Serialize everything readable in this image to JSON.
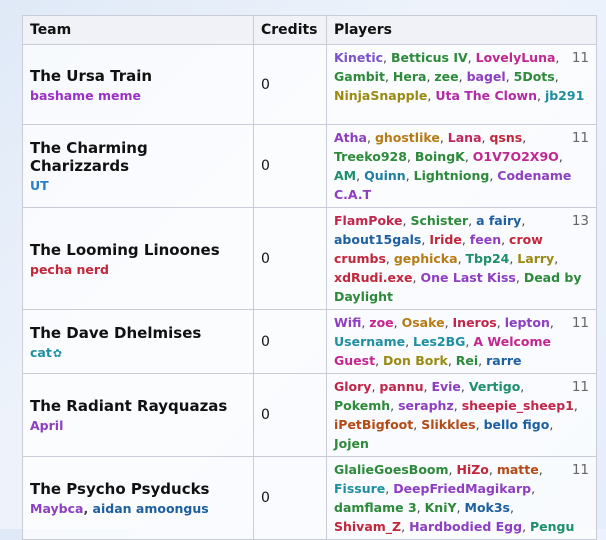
{
  "headers": {
    "team": "Team",
    "credits": "Credits",
    "players": "Players"
  },
  "teams": [
    {
      "name": "The Ursa Train",
      "captains": [
        {
          "name": "bashame meme",
          "color": "#9b30c8"
        }
      ],
      "credits": "0",
      "count": "11",
      "players": [
        {
          "name": "Kinetic",
          "color": "#7a52c9"
        },
        {
          "name": "Betticus IV",
          "color": "#2d8a3a"
        },
        {
          "name": "LovelyLuna",
          "color": "#c2268f"
        },
        {
          "name": "Gambit",
          "color": "#2d8a3a"
        },
        {
          "name": "Hera",
          "color": "#2d8a3a"
        },
        {
          "name": "zee",
          "color": "#2d8a3a"
        },
        {
          "name": "bagel",
          "color": "#8e3fc1"
        },
        {
          "name": "5Dots",
          "color": "#2d8a3a"
        },
        {
          "name": "NinjaSnapple",
          "color": "#9a8a12"
        },
        {
          "name": "Uta The Clown",
          "color": "#b42aa5"
        },
        {
          "name": "jb291",
          "color": "#1e8fa0"
        }
      ]
    },
    {
      "name": "The Charming Charizzards",
      "captains": [
        {
          "name": "UT",
          "color": "#2a7fc9"
        }
      ],
      "credits": "0",
      "count": "11",
      "players": [
        {
          "name": "Atha",
          "color": "#8e3fc1"
        },
        {
          "name": "ghostlike",
          "color": "#b77b14"
        },
        {
          "name": "Lana",
          "color": "#c2265c"
        },
        {
          "name": "qsns",
          "color": "#c2263a"
        },
        {
          "name": "Treeko928",
          "color": "#2d8a3a"
        },
        {
          "name": "BoingK",
          "color": "#2d8a3a"
        },
        {
          "name": "O1V7O2X9O",
          "color": "#c2268f"
        },
        {
          "name": "AM",
          "color": "#1e8f6a"
        },
        {
          "name": "Quinn",
          "color": "#1e7fa0"
        },
        {
          "name": "Lightniong",
          "color": "#2d8a3a"
        },
        {
          "name": "Codename C.A.T",
          "color": "#8e3fc1"
        }
      ]
    },
    {
      "name": "The Looming Linoones",
      "captains": [
        {
          "name": "pecha nerd",
          "color": "#c2263a"
        }
      ],
      "credits": "0",
      "count": "13",
      "players": [
        {
          "name": "FlamPoke",
          "color": "#c2264a"
        },
        {
          "name": "Schister",
          "color": "#2d8a3a"
        },
        {
          "name": "a fairy",
          "color": "#1e5fa0"
        },
        {
          "name": "about15gals",
          "color": "#1e5fa0"
        },
        {
          "name": "Iride",
          "color": "#c2263a"
        },
        {
          "name": "feen",
          "color": "#8e3fc1"
        },
        {
          "name": "crow crumbs",
          "color": "#c2263a"
        },
        {
          "name": "gephicka",
          "color": "#b77b14"
        },
        {
          "name": "Tbp24",
          "color": "#1e8f6a"
        },
        {
          "name": "Larry",
          "color": "#9a8a12"
        },
        {
          "name": "xdRudi.exe",
          "color": "#c2263a"
        },
        {
          "name": "One Last Kiss",
          "color": "#8e3fc1"
        },
        {
          "name": "Dead by Daylight",
          "color": "#2d8a3a"
        }
      ]
    },
    {
      "name": "The Dave Dhelmises",
      "captains": [
        {
          "name": "cat",
          "color": "#1e8fa0",
          "flower": "✿"
        }
      ],
      "credits": "0",
      "count": "11",
      "players": [
        {
          "name": "Wifi",
          "color": "#8e3fc1"
        },
        {
          "name": "zoe",
          "color": "#c2268f"
        },
        {
          "name": "Osake",
          "color": "#b77b14"
        },
        {
          "name": "Ineros",
          "color": "#c2264a"
        },
        {
          "name": "lepton",
          "color": "#8e3fc1"
        },
        {
          "name": "Username",
          "color": "#1e8fa0"
        },
        {
          "name": "Les2BG",
          "color": "#1e8fa0"
        },
        {
          "name": "A Welcome Guest",
          "color": "#c2268f"
        },
        {
          "name": "Don Bork",
          "color": "#9a8a12"
        },
        {
          "name": "Rei",
          "color": "#2d8a3a"
        },
        {
          "name": "rarre",
          "color": "#1e5fa0"
        }
      ]
    },
    {
      "name": "The Radiant Rayquazas",
      "captains": [
        {
          "name": "April",
          "color": "#8e3fc1"
        }
      ],
      "credits": "0",
      "count": "11",
      "players": [
        {
          "name": "Glory",
          "color": "#c2264a"
        },
        {
          "name": "pannu",
          "color": "#c2264a"
        },
        {
          "name": "Evie",
          "color": "#8e3fc1"
        },
        {
          "name": "Vertigo",
          "color": "#1e8f6a"
        },
        {
          "name": "Pokemh",
          "color": "#2d8a3a"
        },
        {
          "name": "seraphz",
          "color": "#8e3fc1"
        },
        {
          "name": "sheepie_sheep1",
          "color": "#c2264a"
        },
        {
          "name": "iPetBigfoot",
          "color": "#b44a14"
        },
        {
          "name": "Slikkles",
          "color": "#b44a14"
        },
        {
          "name": "bello figo",
          "color": "#1e5fa0"
        },
        {
          "name": "Jojen",
          "color": "#2d8a3a"
        }
      ]
    },
    {
      "name": "The Psycho Psyducks",
      "captains": [
        {
          "name": "Maybca",
          "color": "#8e3fc1"
        },
        {
          "name": "aidan amoongus",
          "color": "#1e5fa0"
        }
      ],
      "credits": "0",
      "count": "11",
      "players": [
        {
          "name": "GlalieGoesBoom",
          "color": "#2d8a3a"
        },
        {
          "name": "HiZo",
          "color": "#c2263a"
        },
        {
          "name": "matte",
          "color": "#b44a14"
        },
        {
          "name": "Fissure",
          "color": "#1e8fa0"
        },
        {
          "name": "DeepFriedMagikarp",
          "color": "#8e3fc1"
        },
        {
          "name": "damflame 3",
          "color": "#2d8a3a"
        },
        {
          "name": "KniY",
          "color": "#2d8a3a"
        },
        {
          "name": "Mok3s",
          "color": "#1e5fa0"
        },
        {
          "name": "Shivam_Z",
          "color": "#c2263a"
        },
        {
          "name": "Hardbodied Egg",
          "color": "#8e3fc1"
        },
        {
          "name": "Pengu",
          "color": "#1e8f6a"
        }
      ]
    }
  ]
}
